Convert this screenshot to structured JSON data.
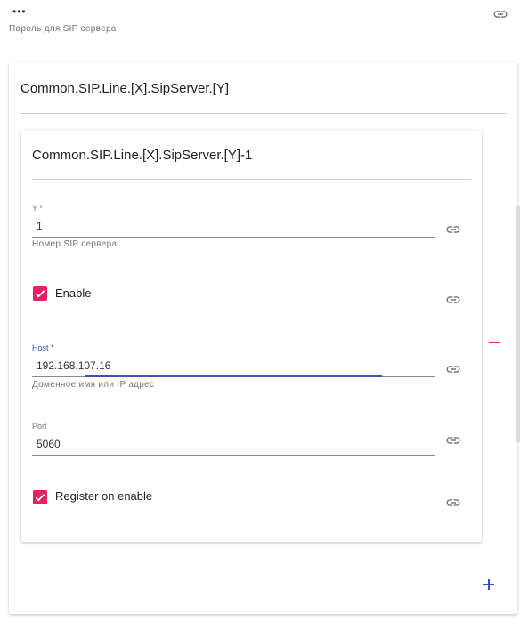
{
  "top_field": {
    "value": "•••",
    "hint": "Пароль для SIP сервера"
  },
  "outer_section": {
    "title": "Common.SIP.Line.[X].SipServer.[Y]"
  },
  "inner_section": {
    "title": "Common.SIP.Line.[X].SipServer.[Y]-1",
    "y_field": {
      "label": "Y *",
      "value": "1",
      "hint": "Номер SIP сервера"
    },
    "enable": {
      "label": "Enable",
      "checked": true
    },
    "host_field": {
      "label": "Host *",
      "value": "192.168.107.16",
      "hint": "Доменное имя или IP адрес"
    },
    "port_field": {
      "label": "Port",
      "value": "5060"
    },
    "register": {
      "label": "Register on enable",
      "checked": true
    }
  },
  "icons": {
    "link": "link-icon",
    "remove": "minus-icon",
    "add": "plus-icon",
    "check": "check-icon"
  },
  "colors": {
    "accent_pink": "#e91e63",
    "primary_indigo": "#3f51b5"
  }
}
